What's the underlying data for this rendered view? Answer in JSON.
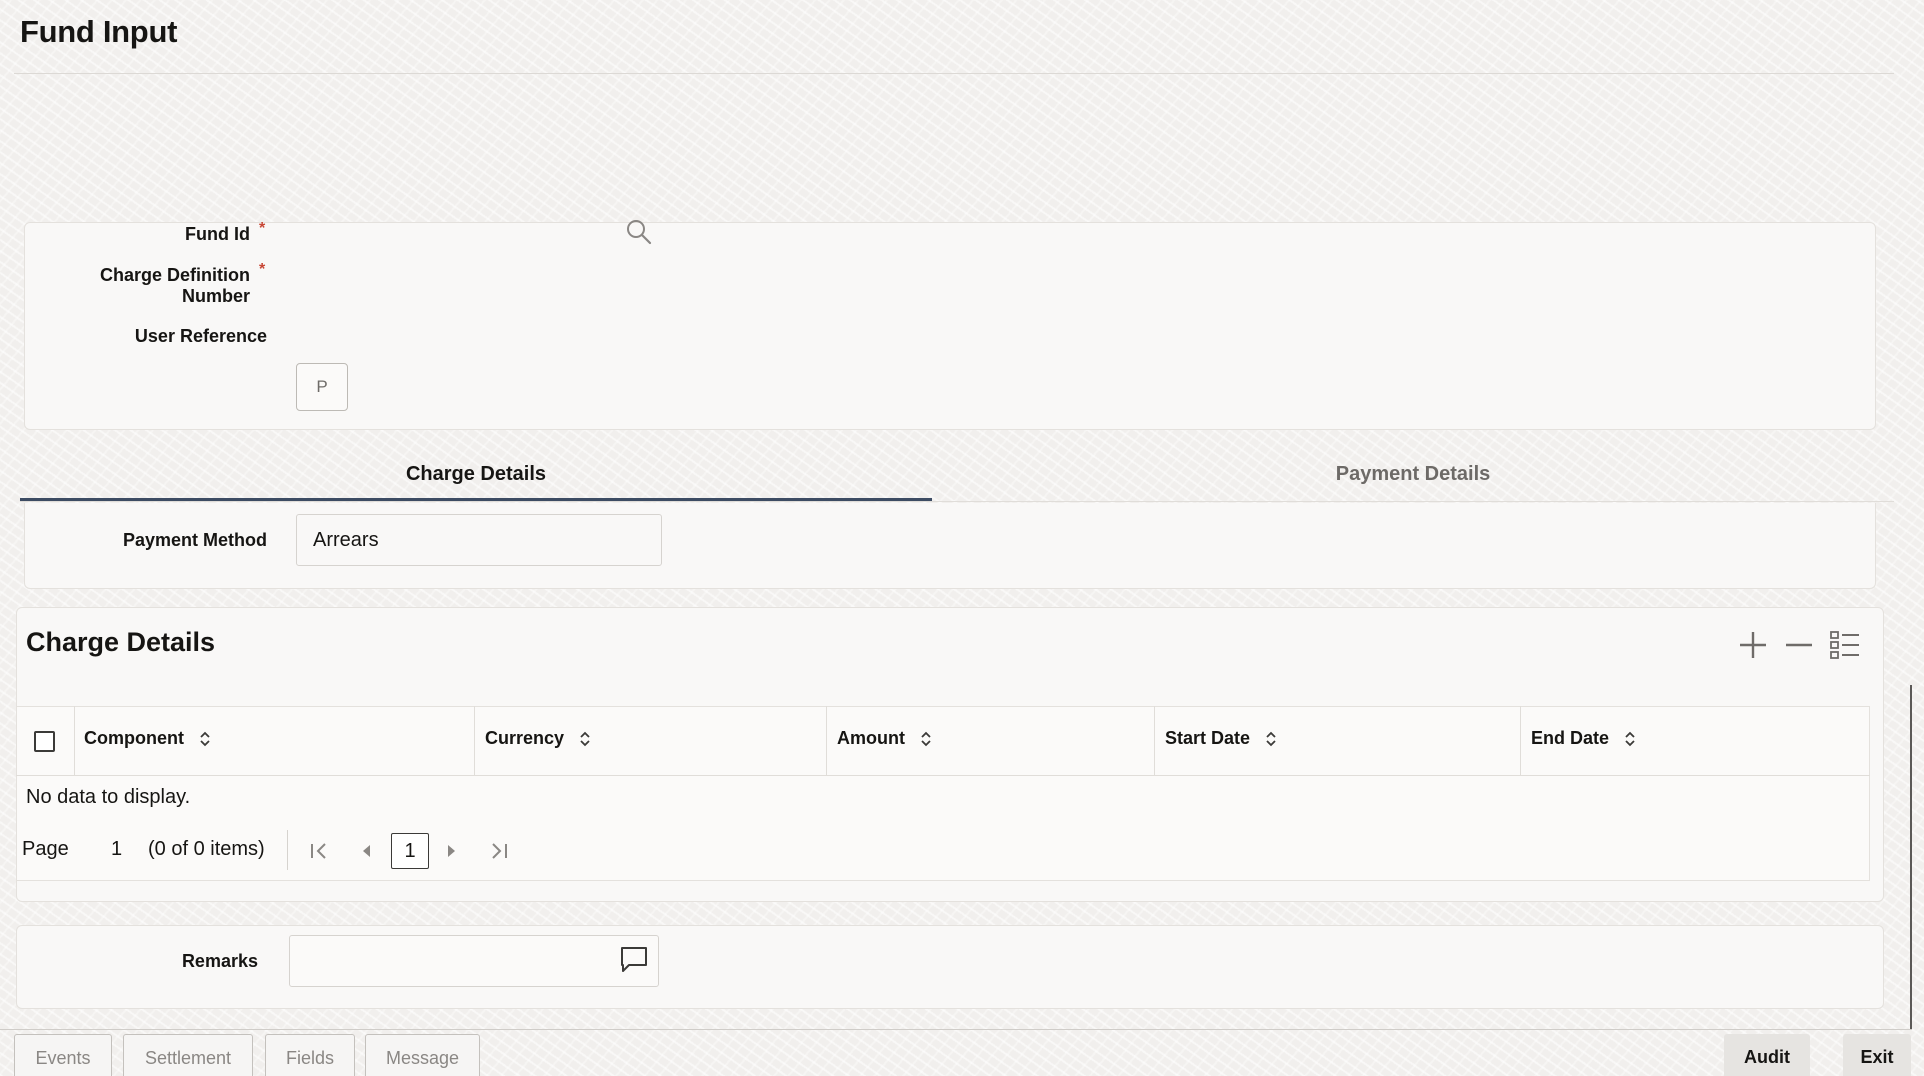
{
  "page": {
    "title": "Fund Input"
  },
  "header": {
    "fund_id_label": "Fund Id",
    "charge_def_label_line1": "Charge Definition",
    "charge_def_label_line2": "Number",
    "user_ref_label": "User Reference",
    "required_mark": "*",
    "p_button_label": "P"
  },
  "tabs": [
    {
      "label": "Charge Details",
      "active": true
    },
    {
      "label": "Payment Details",
      "active": false
    }
  ],
  "payment": {
    "method_label": "Payment Method",
    "method_value": "Arrears"
  },
  "charge_details": {
    "title": "Charge Details",
    "tools": [
      "plus-icon",
      "minus-icon",
      "list-icon"
    ],
    "columns": [
      "Component",
      "Currency",
      "Amount",
      "Start Date",
      "End Date"
    ],
    "empty_text": "No data to display.",
    "pager": {
      "page_label": "Page",
      "page_number": "1",
      "items_text": "(0 of 0 items)",
      "current_page": "1"
    }
  },
  "remarks": {
    "label": "Remarks"
  },
  "footer": {
    "left_buttons": [
      "Events",
      "Settlement",
      "Fields",
      "Message"
    ],
    "audit_label": "Audit",
    "exit_label": "Exit"
  },
  "colors": {
    "accent": "#3d4c63",
    "required": "#c74634"
  }
}
